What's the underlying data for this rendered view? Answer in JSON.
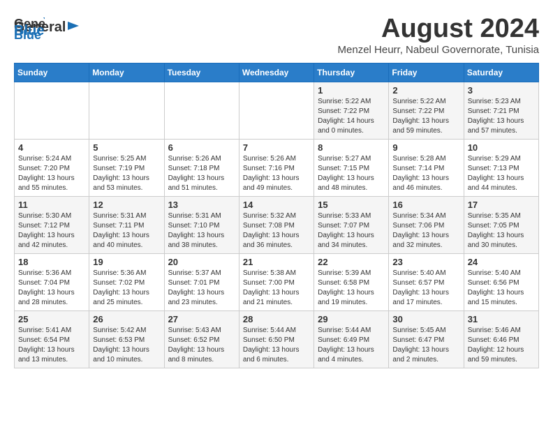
{
  "logo": {
    "line1": "General",
    "line2": "Blue"
  },
  "title": "August 2024",
  "subtitle": "Menzel Heurr, Nabeul Governorate, Tunisia",
  "days_header": [
    "Sunday",
    "Monday",
    "Tuesday",
    "Wednesday",
    "Thursday",
    "Friday",
    "Saturday"
  ],
  "weeks": [
    [
      {
        "day": "",
        "info": ""
      },
      {
        "day": "",
        "info": ""
      },
      {
        "day": "",
        "info": ""
      },
      {
        "day": "",
        "info": ""
      },
      {
        "day": "1",
        "info": "Sunrise: 5:22 AM\nSunset: 7:22 PM\nDaylight: 14 hours\nand 0 minutes."
      },
      {
        "day": "2",
        "info": "Sunrise: 5:22 AM\nSunset: 7:22 PM\nDaylight: 13 hours\nand 59 minutes."
      },
      {
        "day": "3",
        "info": "Sunrise: 5:23 AM\nSunset: 7:21 PM\nDaylight: 13 hours\nand 57 minutes."
      }
    ],
    [
      {
        "day": "4",
        "info": "Sunrise: 5:24 AM\nSunset: 7:20 PM\nDaylight: 13 hours\nand 55 minutes."
      },
      {
        "day": "5",
        "info": "Sunrise: 5:25 AM\nSunset: 7:19 PM\nDaylight: 13 hours\nand 53 minutes."
      },
      {
        "day": "6",
        "info": "Sunrise: 5:26 AM\nSunset: 7:18 PM\nDaylight: 13 hours\nand 51 minutes."
      },
      {
        "day": "7",
        "info": "Sunrise: 5:26 AM\nSunset: 7:16 PM\nDaylight: 13 hours\nand 49 minutes."
      },
      {
        "day": "8",
        "info": "Sunrise: 5:27 AM\nSunset: 7:15 PM\nDaylight: 13 hours\nand 48 minutes."
      },
      {
        "day": "9",
        "info": "Sunrise: 5:28 AM\nSunset: 7:14 PM\nDaylight: 13 hours\nand 46 minutes."
      },
      {
        "day": "10",
        "info": "Sunrise: 5:29 AM\nSunset: 7:13 PM\nDaylight: 13 hours\nand 44 minutes."
      }
    ],
    [
      {
        "day": "11",
        "info": "Sunrise: 5:30 AM\nSunset: 7:12 PM\nDaylight: 13 hours\nand 42 minutes."
      },
      {
        "day": "12",
        "info": "Sunrise: 5:31 AM\nSunset: 7:11 PM\nDaylight: 13 hours\nand 40 minutes."
      },
      {
        "day": "13",
        "info": "Sunrise: 5:31 AM\nSunset: 7:10 PM\nDaylight: 13 hours\nand 38 minutes."
      },
      {
        "day": "14",
        "info": "Sunrise: 5:32 AM\nSunset: 7:08 PM\nDaylight: 13 hours\nand 36 minutes."
      },
      {
        "day": "15",
        "info": "Sunrise: 5:33 AM\nSunset: 7:07 PM\nDaylight: 13 hours\nand 34 minutes."
      },
      {
        "day": "16",
        "info": "Sunrise: 5:34 AM\nSunset: 7:06 PM\nDaylight: 13 hours\nand 32 minutes."
      },
      {
        "day": "17",
        "info": "Sunrise: 5:35 AM\nSunset: 7:05 PM\nDaylight: 13 hours\nand 30 minutes."
      }
    ],
    [
      {
        "day": "18",
        "info": "Sunrise: 5:36 AM\nSunset: 7:04 PM\nDaylight: 13 hours\nand 28 minutes."
      },
      {
        "day": "19",
        "info": "Sunrise: 5:36 AM\nSunset: 7:02 PM\nDaylight: 13 hours\nand 25 minutes."
      },
      {
        "day": "20",
        "info": "Sunrise: 5:37 AM\nSunset: 7:01 PM\nDaylight: 13 hours\nand 23 minutes."
      },
      {
        "day": "21",
        "info": "Sunrise: 5:38 AM\nSunset: 7:00 PM\nDaylight: 13 hours\nand 21 minutes."
      },
      {
        "day": "22",
        "info": "Sunrise: 5:39 AM\nSunset: 6:58 PM\nDaylight: 13 hours\nand 19 minutes."
      },
      {
        "day": "23",
        "info": "Sunrise: 5:40 AM\nSunset: 6:57 PM\nDaylight: 13 hours\nand 17 minutes."
      },
      {
        "day": "24",
        "info": "Sunrise: 5:40 AM\nSunset: 6:56 PM\nDaylight: 13 hours\nand 15 minutes."
      }
    ],
    [
      {
        "day": "25",
        "info": "Sunrise: 5:41 AM\nSunset: 6:54 PM\nDaylight: 13 hours\nand 13 minutes."
      },
      {
        "day": "26",
        "info": "Sunrise: 5:42 AM\nSunset: 6:53 PM\nDaylight: 13 hours\nand 10 minutes."
      },
      {
        "day": "27",
        "info": "Sunrise: 5:43 AM\nSunset: 6:52 PM\nDaylight: 13 hours\nand 8 minutes."
      },
      {
        "day": "28",
        "info": "Sunrise: 5:44 AM\nSunset: 6:50 PM\nDaylight: 13 hours\nand 6 minutes."
      },
      {
        "day": "29",
        "info": "Sunrise: 5:44 AM\nSunset: 6:49 PM\nDaylight: 13 hours\nand 4 minutes."
      },
      {
        "day": "30",
        "info": "Sunrise: 5:45 AM\nSunset: 6:47 PM\nDaylight: 13 hours\nand 2 minutes."
      },
      {
        "day": "31",
        "info": "Sunrise: 5:46 AM\nSunset: 6:46 PM\nDaylight: 12 hours\nand 59 minutes."
      }
    ]
  ]
}
